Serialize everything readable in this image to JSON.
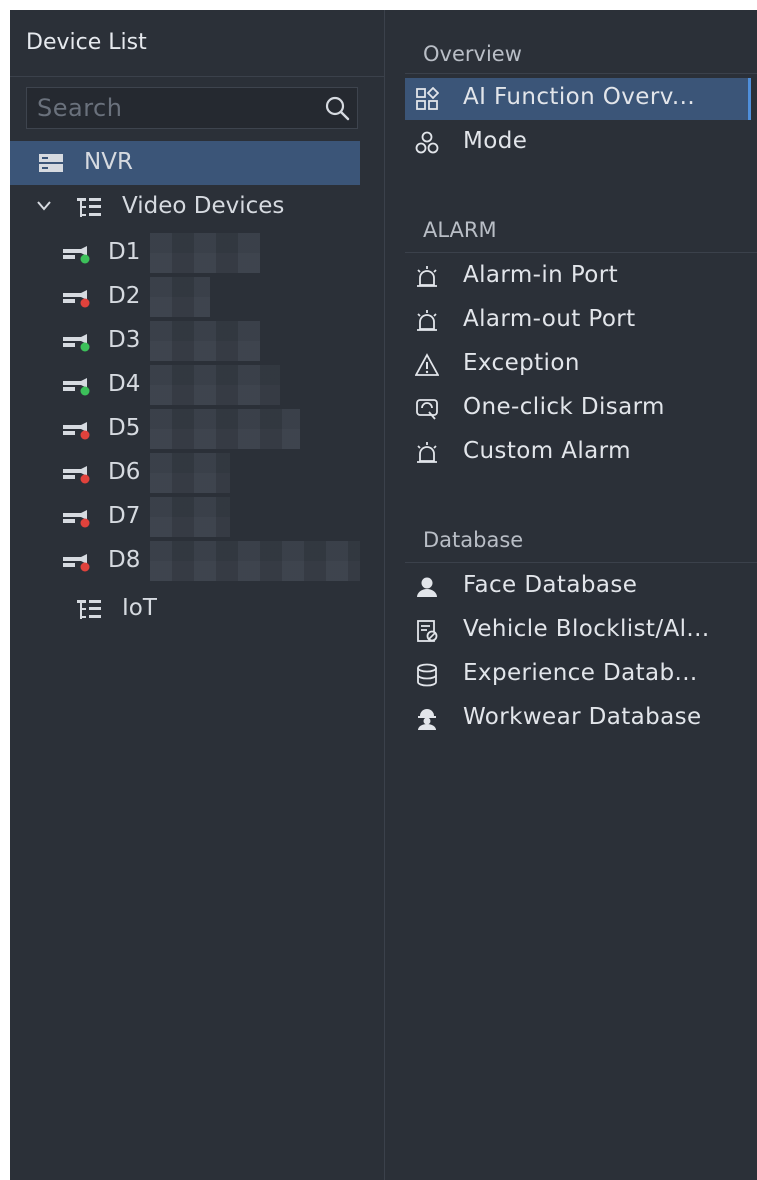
{
  "device_list": {
    "title": "Device List",
    "search_placeholder": "Search",
    "nvr_label": "NVR",
    "video_devices_label": "Video Devices",
    "devices": [
      {
        "label": "D1",
        "status_color": "#3cc05a"
      },
      {
        "label": "D2",
        "status_color": "#e0423c"
      },
      {
        "label": "D3",
        "status_color": "#3cc05a"
      },
      {
        "label": "D4",
        "status_color": "#3cc05a"
      },
      {
        "label": "D5",
        "status_color": "#e0423c"
      },
      {
        "label": "D6",
        "status_color": "#e0423c"
      },
      {
        "label": "D7",
        "status_color": "#e0423c"
      },
      {
        "label": "D8",
        "status_color": "#e0423c"
      }
    ],
    "iot_label": "IoT"
  },
  "menu": {
    "overview": {
      "title": "Overview",
      "items": [
        {
          "label": "AI Function Overv...",
          "icon": "grid-icon"
        },
        {
          "label": "Mode",
          "icon": "mode-icon"
        }
      ]
    },
    "alarm": {
      "title": "ALARM",
      "items": [
        {
          "label": "Alarm-in Port",
          "icon": "alarm-in-icon"
        },
        {
          "label": "Alarm-out Port",
          "icon": "alarm-out-icon"
        },
        {
          "label": "Exception",
          "icon": "warning-icon"
        },
        {
          "label": "One-click Disarm",
          "icon": "disarm-icon"
        },
        {
          "label": "Custom Alarm",
          "icon": "custom-alarm-icon"
        }
      ]
    },
    "database": {
      "title": "Database",
      "items": [
        {
          "label": "Face Database",
          "icon": "person-icon"
        },
        {
          "label": "Vehicle Blocklist/Al...",
          "icon": "vehicle-list-icon"
        },
        {
          "label": "Experience Datab...",
          "icon": "database-icon"
        },
        {
          "label": "Workwear Database",
          "icon": "worker-icon"
        }
      ]
    }
  },
  "colors": {
    "background": "#2b3038",
    "selected": "#3b5578",
    "accent": "#4e8fdc"
  }
}
